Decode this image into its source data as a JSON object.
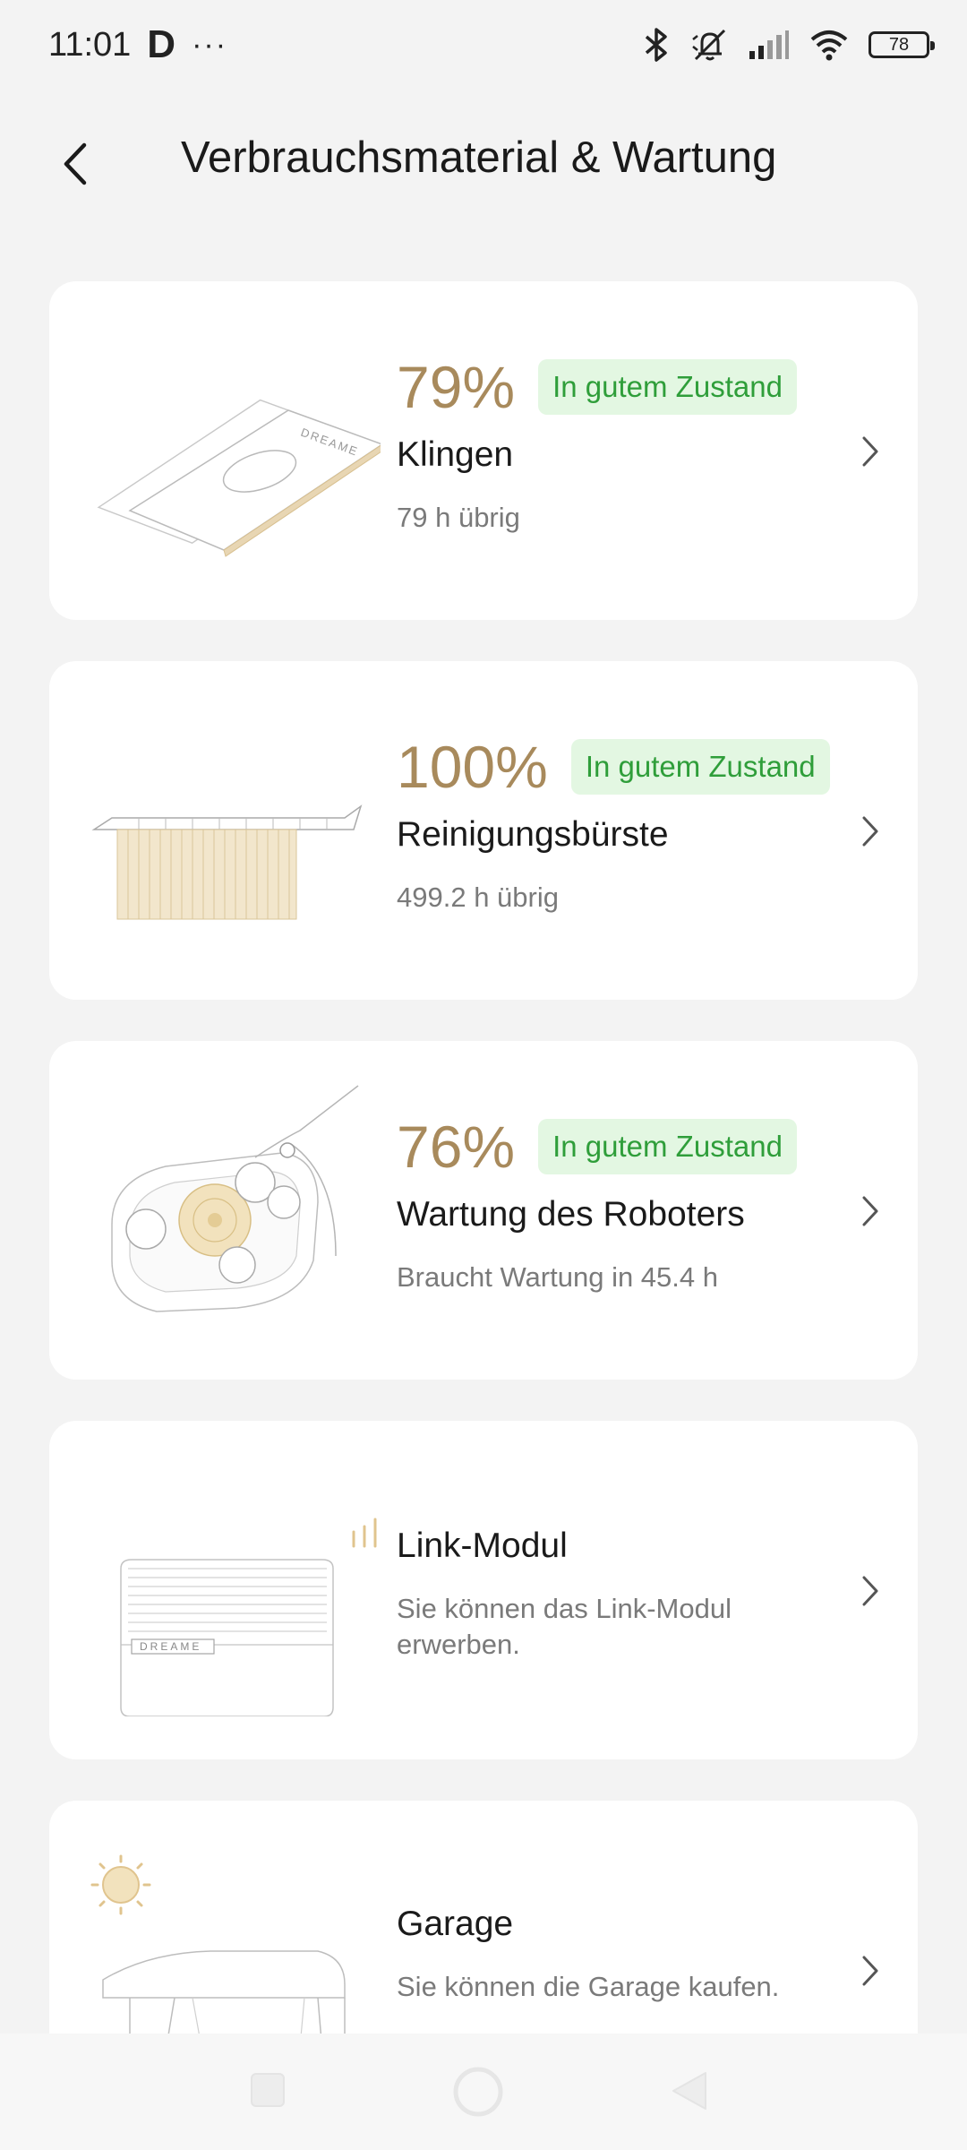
{
  "status_bar": {
    "time": "11:01",
    "app_logo": "D",
    "more": "···",
    "battery": "78",
    "icons": [
      "bluetooth-icon",
      "muted-icon",
      "signal-icon",
      "wifi-icon",
      "battery-icon"
    ]
  },
  "header": {
    "title": "Verbrauchsmaterial & Wartung",
    "back_icon": "chevron-left-icon"
  },
  "colors": {
    "accent": "#a88a5c",
    "badge_bg": "#e3f7e2",
    "badge_text": "#2f9e3a",
    "background": "#f3f3f3"
  },
  "items": [
    {
      "percent": "79%",
      "status": "In gutem Zustand",
      "name": "Klingen",
      "sub": "79 h übrig",
      "illustration": "blade-plate",
      "illustration_label": "DREAME"
    },
    {
      "percent": "100%",
      "status": "In gutem Zustand",
      "name": "Reinigungsbürste",
      "sub": "499.2 h übrig",
      "illustration": "cleaning-brush"
    },
    {
      "percent": "76%",
      "status": "In gutem Zustand",
      "name": "Wartung des Roboters",
      "sub": "Braucht Wartung in 45.4 h",
      "illustration": "robot-underside"
    },
    {
      "name": "Link-Modul",
      "sub": "Sie können das Link-Modul erwerben.",
      "illustration": "link-module",
      "illustration_label": "DREAME"
    },
    {
      "name": "Garage",
      "sub": "Sie können die Garage kaufen.",
      "illustration": "garage-with-sun"
    }
  ],
  "nav": {
    "recent": "square-icon",
    "home": "circle-icon",
    "back": "triangle-back-icon"
  }
}
